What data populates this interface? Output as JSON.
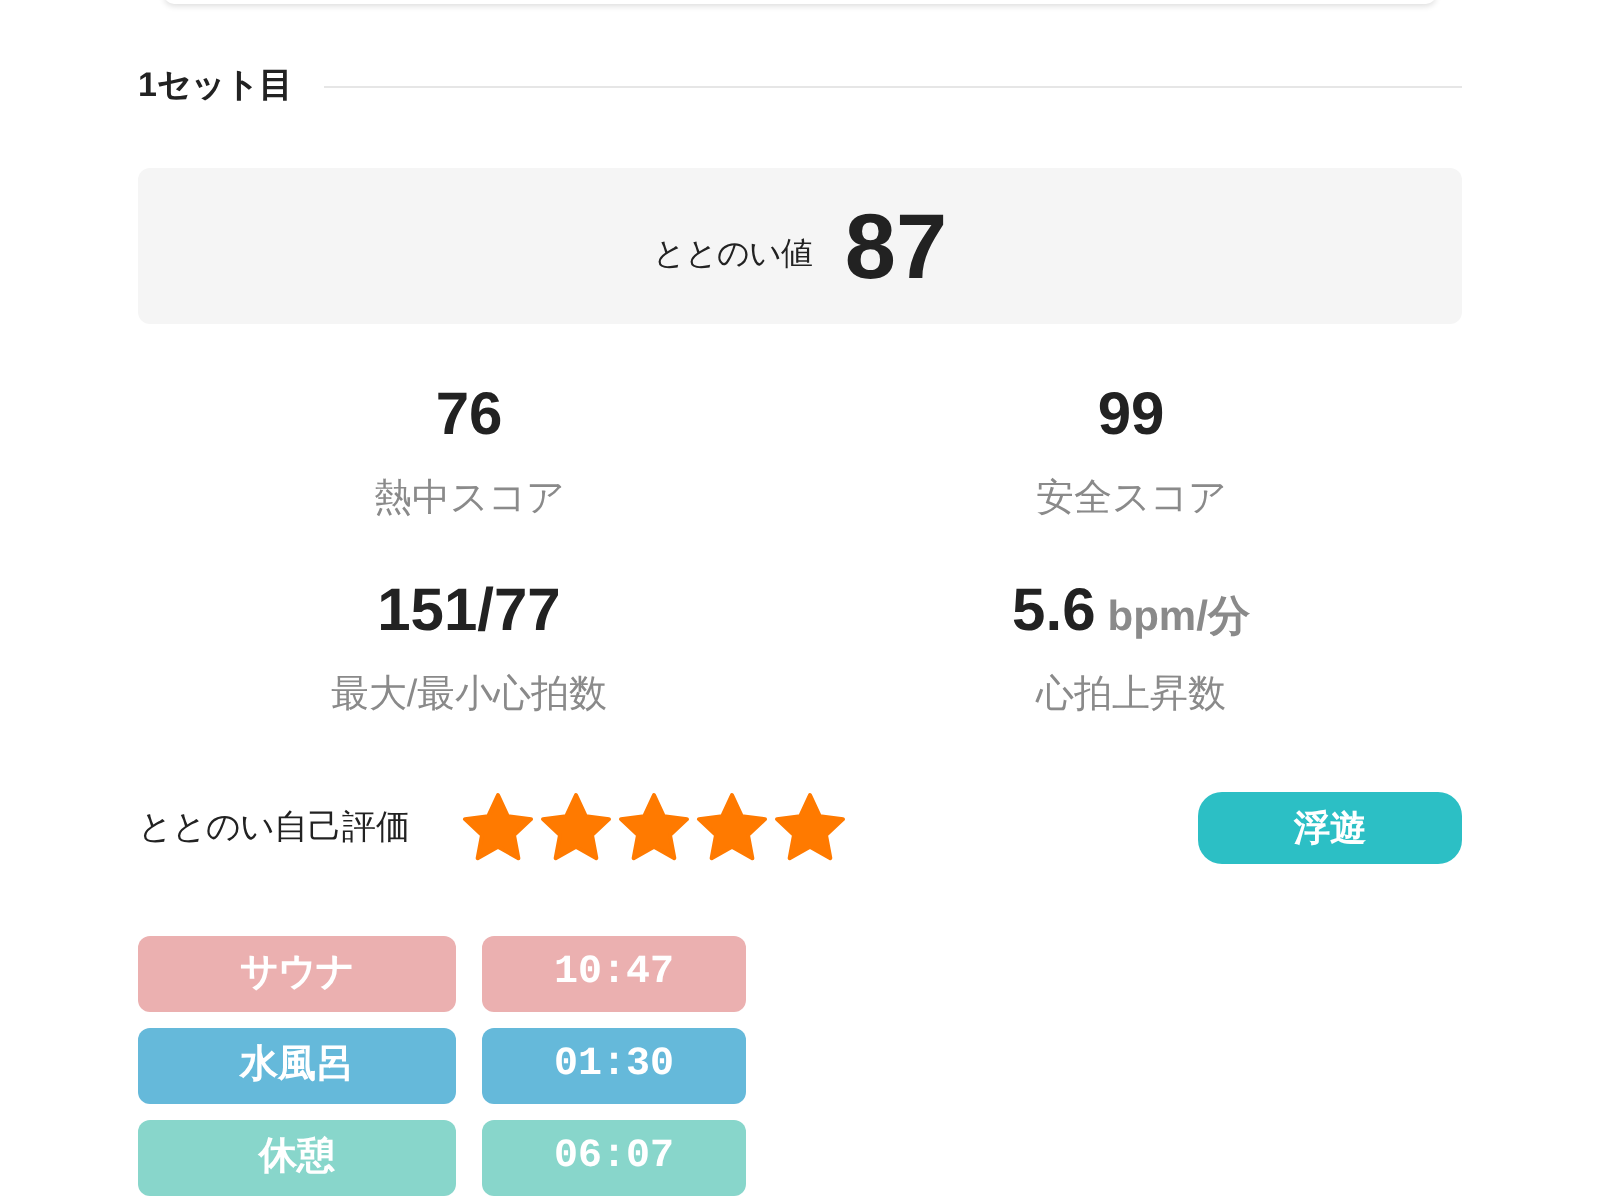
{
  "set": {
    "title": "1セット目",
    "score": {
      "label": "ととのい値",
      "value": "87"
    },
    "stats": [
      {
        "value": "76",
        "label": "熱中スコア"
      },
      {
        "value": "99",
        "label": "安全スコア"
      },
      {
        "value": "151/77",
        "label": "最大/最小心拍数"
      },
      {
        "value": "5.6",
        "unit": "bpm/分",
        "label": "心拍上昇数"
      }
    ],
    "self_rating": {
      "label": "ととのい自己評価",
      "stars": 5,
      "tag": "浮遊"
    },
    "phases": [
      {
        "name": "サウナ",
        "time": "10:47",
        "color": "#ebb0b0"
      },
      {
        "name": "水風呂",
        "time": "01:30",
        "color": "#65b9da"
      },
      {
        "name": "休憩",
        "time": "06:07",
        "color": "#88d6cb"
      }
    ]
  }
}
